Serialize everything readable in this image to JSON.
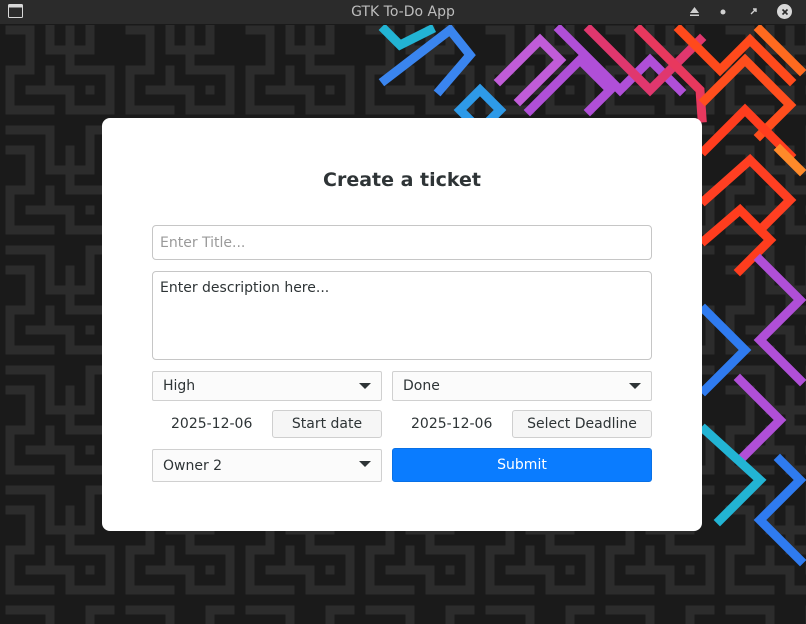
{
  "window": {
    "title": "GTK To-Do App",
    "icons": [
      "app-window-icon",
      "keep-above-icon",
      "minimize-icon",
      "maximize-icon",
      "close-icon"
    ]
  },
  "form": {
    "heading": "Create a ticket",
    "title_placeholder": "Enter Title...",
    "description_placeholder": "Enter description here...",
    "priority": {
      "selected": "High",
      "icon": "chevron-down-icon"
    },
    "status": {
      "selected": "Done",
      "icon": "chevron-down-icon"
    },
    "start_date": {
      "value": "2025-12-06",
      "button_label": "Start date"
    },
    "deadline": {
      "value": "2025-12-06",
      "button_label": "Select Deadline"
    },
    "owner": {
      "selected": "Owner 2",
      "icon": "chevron-down-icon"
    },
    "submit_label": "Submit"
  },
  "colors": {
    "accent": "#0a7cff",
    "card_background": "#ffffff",
    "wallpaper_background": "#1b1b1b"
  }
}
